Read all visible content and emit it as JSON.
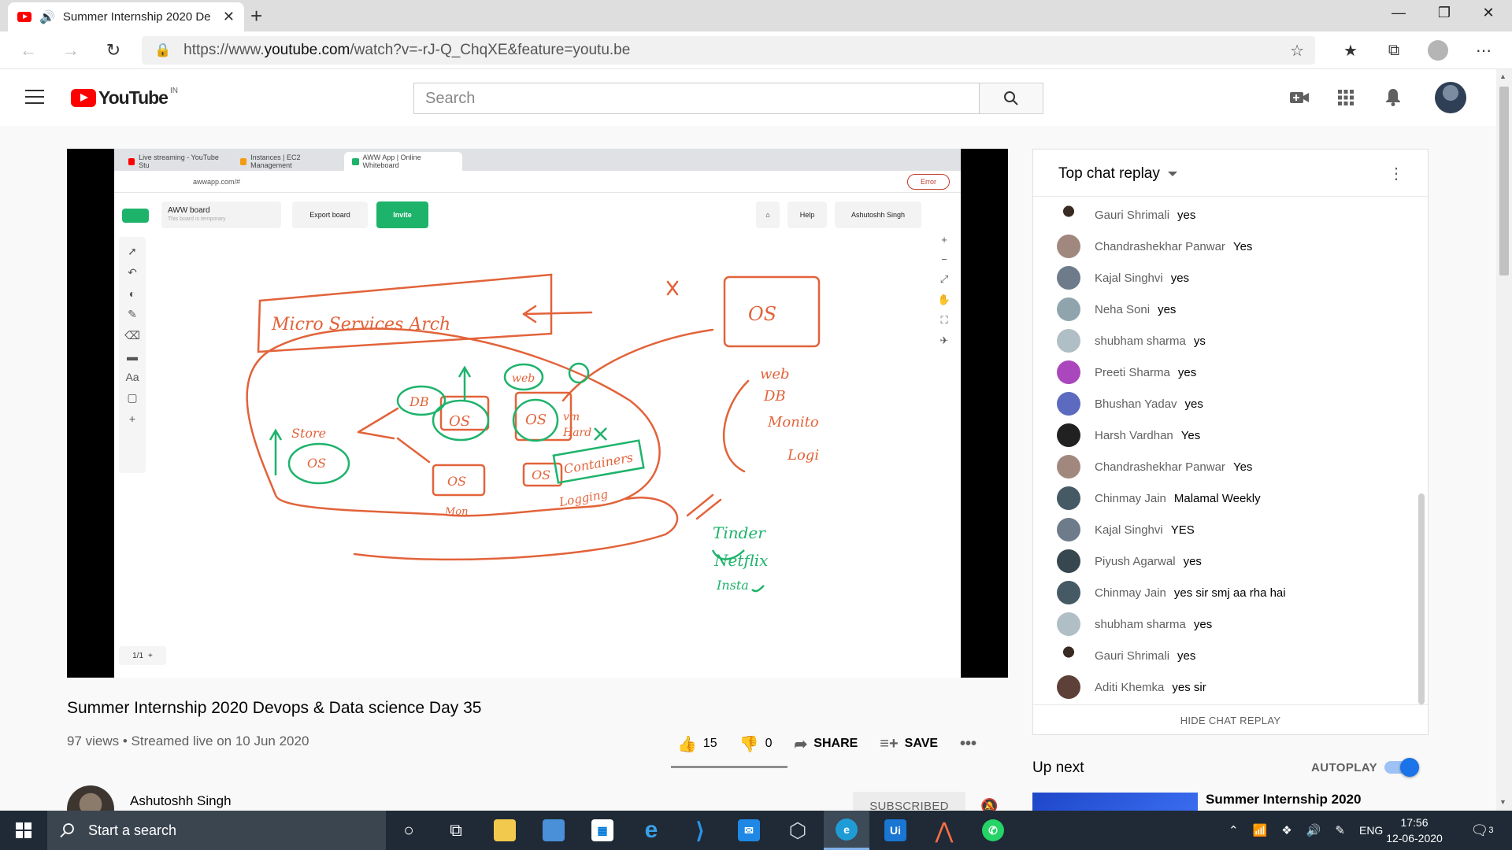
{
  "browser": {
    "tab_title": "Summer Internship 2020 De",
    "url_prefix": "https://www.",
    "url_domain": "youtube.com",
    "url_rest": "/watch?v=-rJ-Q_ChqXE&feature=youtu.be"
  },
  "youtube": {
    "logo_text": "YouTube",
    "country": "IN",
    "search_placeholder": "Search"
  },
  "video": {
    "title": "Summer Internship 2020 Devops & Data science Day 35",
    "meta": "97 views • Streamed live on 10 Jun 2020",
    "likes": "15",
    "dislikes": "0",
    "share_label": "SHARE",
    "save_label": "SAVE",
    "like_ratio": 1.0
  },
  "screen": {
    "tabs": [
      "Live streaming - YouTube Stu",
      "Instances | EC2 Management",
      "AWW App | Online Whiteboard"
    ],
    "url": "awwapp.com/#",
    "error_label": "Error",
    "board_name": "AWW board",
    "board_note": "This board is temporary",
    "export_label": "Export board",
    "invite_label": "Invite",
    "help_label": "Help",
    "user_label": "Ashutoshh Singh",
    "page_label": "1/1"
  },
  "channel": {
    "name": "Ashutoshh Singh",
    "subscribed_label": "SUBSCRIBED"
  },
  "chat": {
    "title": "Top chat replay",
    "hide_label": "HIDE CHAT REPLAY",
    "messages": [
      {
        "author": "Gauri Shrimali",
        "text": "yes",
        "color": "#ffffff"
      },
      {
        "author": "Chandrashekhar Panwar",
        "text": "Yes",
        "color": "#a1887f"
      },
      {
        "author": "Kajal Singhvi",
        "text": "yes",
        "color": "#6d7b8a"
      },
      {
        "author": "Neha Soni",
        "text": "yes",
        "color": "#90a4ae"
      },
      {
        "author": "shubham sharma",
        "text": "ys",
        "color": "#b0bec5"
      },
      {
        "author": "Preeti Sharma",
        "text": "yes",
        "color": "#ab47bc"
      },
      {
        "author": "Bhushan Yadav",
        "text": "yes",
        "color": "#5c6bc0"
      },
      {
        "author": "Harsh Vardhan",
        "text": "Yes",
        "color": "#212121"
      },
      {
        "author": "Chandrashekhar Panwar",
        "text": "Yes",
        "color": "#a1887f"
      },
      {
        "author": "Chinmay Jain",
        "text": "Malamal Weekly",
        "color": "#455a64"
      },
      {
        "author": "Kajal Singhvi",
        "text": "YES",
        "color": "#6d7b8a"
      },
      {
        "author": "Piyush Agarwal",
        "text": "yes",
        "color": "#37474f"
      },
      {
        "author": "Chinmay Jain",
        "text": "yes sir smj aa rha hai",
        "color": "#455a64"
      },
      {
        "author": "shubham sharma",
        "text": "yes",
        "color": "#b0bec5"
      },
      {
        "author": "Gauri Shrimali",
        "text": "yes",
        "color": "#ffffff"
      },
      {
        "author": "Aditi Khemka",
        "text": "yes sir",
        "color": "#5d4037"
      }
    ]
  },
  "upnext": {
    "label": "Up next",
    "autoplay_label": "AUTOPLAY",
    "autoplay_on": true,
    "next_title": "Summer Internship 2020"
  },
  "taskbar": {
    "search_placeholder": "Start a search",
    "lang": "ENG",
    "time": "17:56",
    "date": "12-06-2020",
    "notifications": "3"
  },
  "whiteboard_text": [
    "Micro Services Arch",
    "OS",
    "web",
    "DB",
    "Monito",
    "Logi",
    "DB",
    "OS",
    "web",
    "OS",
    "Store",
    "OS",
    "vm",
    "Hard",
    "Containers",
    "OS",
    "OS",
    "Mon",
    "Logging",
    "Tinder",
    "Netflix",
    "Insta"
  ]
}
